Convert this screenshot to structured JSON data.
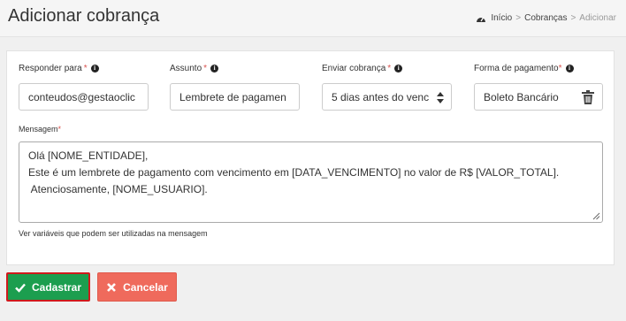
{
  "header": {
    "title": "Adicionar cobrança",
    "breadcrumb": [
      {
        "label": "Início"
      },
      {
        "label": "Cobranças"
      },
      {
        "label": "Adicionar"
      }
    ],
    "separator": ">"
  },
  "form": {
    "reply_to": {
      "label": "Responder para",
      "required_mark": "*",
      "value": "conteudos@gestaoclic"
    },
    "subject": {
      "label": "Assunto",
      "required_mark": "*",
      "value": "Lembrete de pagamen"
    },
    "send_when": {
      "label": "Enviar cobrança",
      "required_mark": "*",
      "value": "5 dias antes do venc"
    },
    "payment_method": {
      "label": "Forma de pagamento",
      "required_mark": "*",
      "value": "Boleto Bancário"
    },
    "message": {
      "label": "Mensagem",
      "required_mark": "*",
      "lines": [
        "Olá [NOME_ENTIDADE],",
        "Este é um lembrete de pagamento com vencimento em [DATA_VENCIMENTO] no valor de R$ [VALOR_TOTAL].",
        " Atenciosamente, [NOME_USUARIO]."
      ]
    },
    "variables_link": "Ver variáveis que podem ser utilizadas na mensagem"
  },
  "actions": {
    "submit_label": "Cadastrar",
    "cancel_label": "Cancelar"
  },
  "colors": {
    "submit": "#1c9e4f",
    "submit_outline": "#d0191c",
    "cancel": "#ef6a5c",
    "required": "#d9534f"
  },
  "icons": {
    "breadcrumb_home": "dashboard-icon",
    "info": "info-circle-icon",
    "select": "sort-arrows-icon",
    "remove": "trash-icon",
    "submit": "check-icon",
    "cancel": "times-icon"
  }
}
